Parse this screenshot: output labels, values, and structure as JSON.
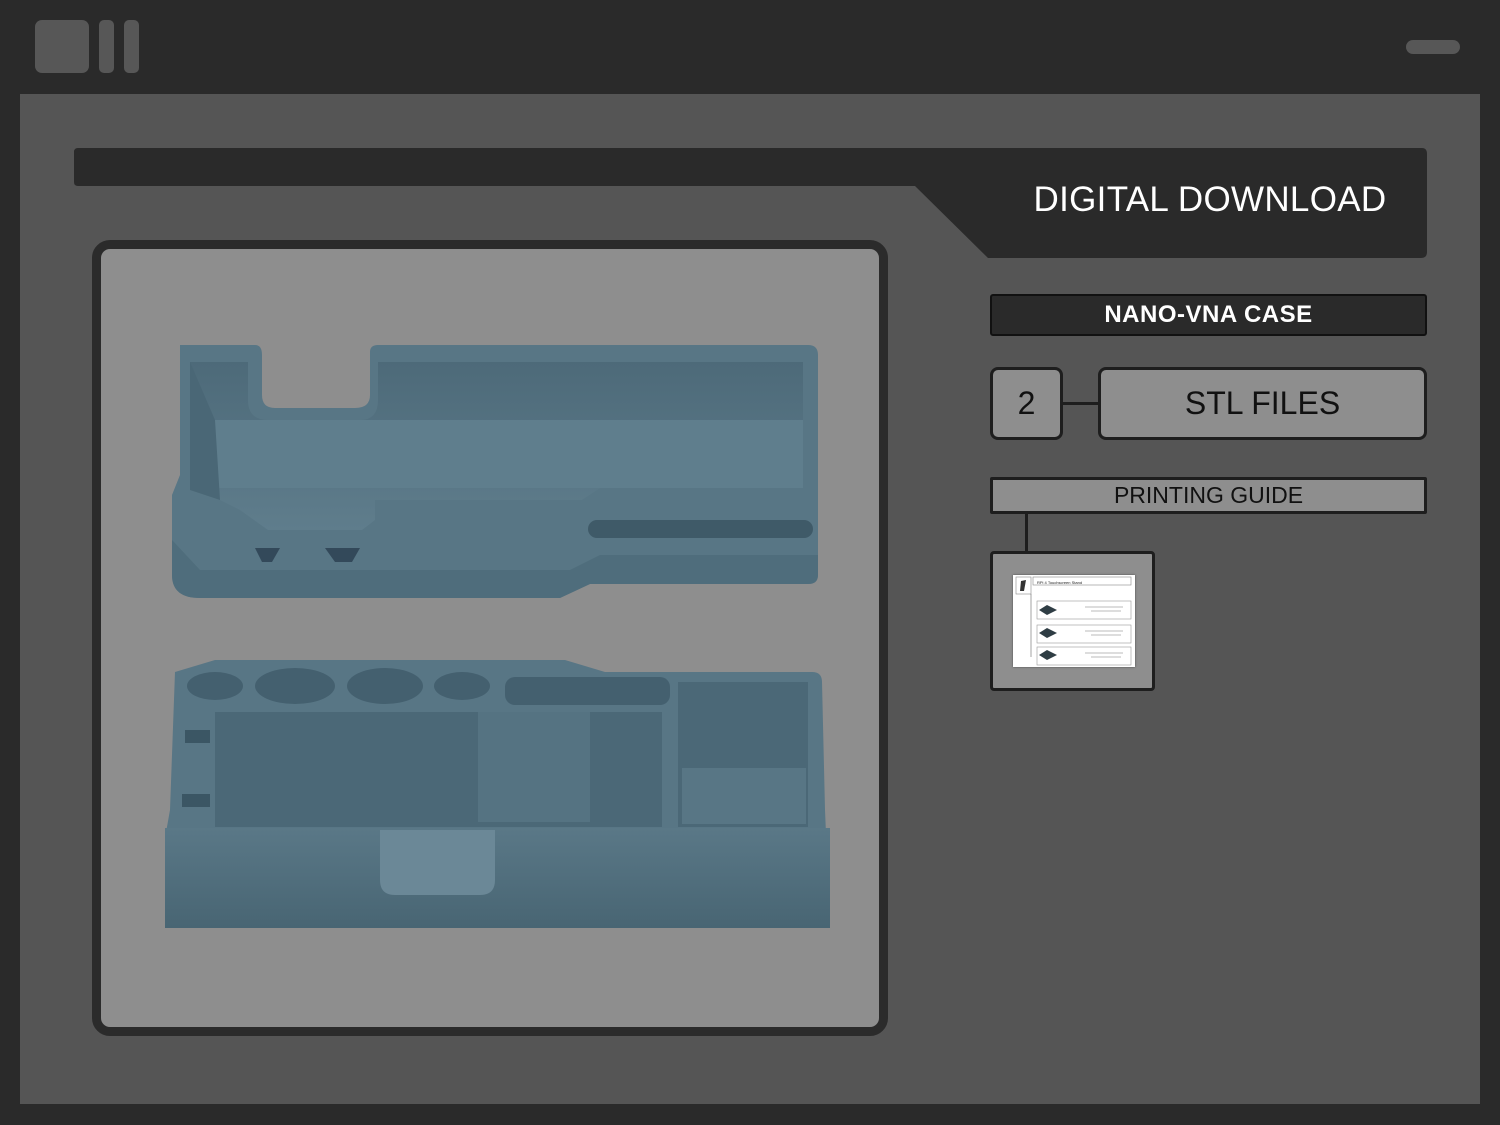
{
  "window": {
    "controls": [
      "app-icon",
      "pause-icon",
      "minimize-icon"
    ]
  },
  "header": {
    "title": "DIGITAL DOWNLOAD"
  },
  "product": {
    "name": "NANO-VNA CASE"
  },
  "files": {
    "count": "2",
    "type": "STL FILES"
  },
  "guide": {
    "label": "PRINTING GUIDE",
    "thumbnail_title": "RPi 4 Touchscreen Stand"
  },
  "colors": {
    "frame_dark": "#2a2a2a",
    "panel": "#555555",
    "box_gray": "#8e8e8e",
    "model_blue": "#587685"
  }
}
